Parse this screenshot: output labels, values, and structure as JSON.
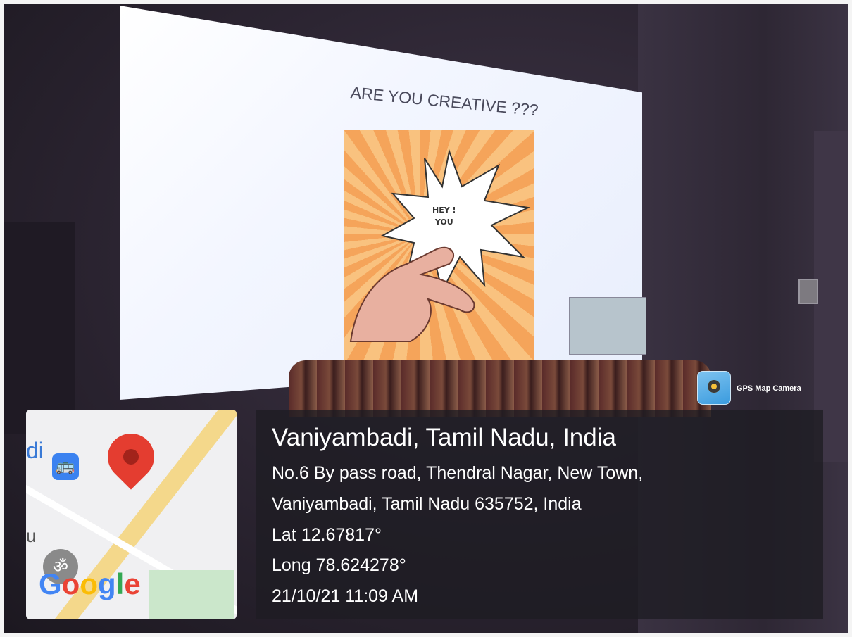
{
  "slide": {
    "title": "ARE YOU CREATIVE ???",
    "burst_line1": "HEY !",
    "burst_line2": "YOU"
  },
  "badge": {
    "label": "GPS Map Camera",
    "icon": "gps-map-camera-icon"
  },
  "map": {
    "partial_label": "di",
    "partial_label2": "u",
    "logo": "Google",
    "bus_icon": "bus-icon",
    "pin_icon": "map-pin-icon",
    "place_icon": "om-symbol-icon",
    "pin_color": "#e43d30"
  },
  "location": {
    "title": "Vaniyambadi, Tamil Nadu, India",
    "address_line1": "No.6 By pass road, Thendral Nagar, New Town,",
    "address_line2": "Vaniyambadi, Tamil Nadu 635752, India",
    "lat": "Lat 12.67817°",
    "long": "Long 78.624278°",
    "datetime": "21/10/21 11:09 AM"
  }
}
